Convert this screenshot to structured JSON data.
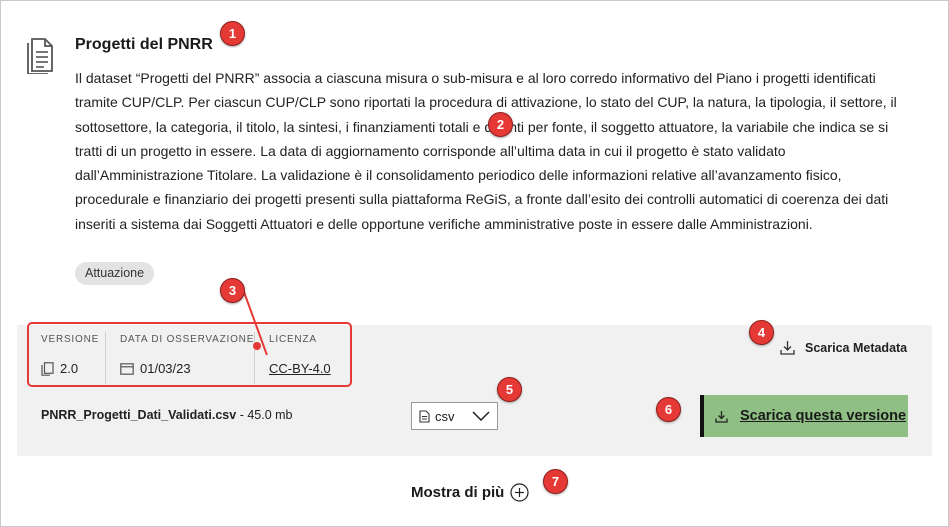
{
  "dataset": {
    "title": "Progetti del PNRR",
    "description": "Il dataset “Progetti del PNRR” associa a ciascuna misura o sub-misura e al loro corredo informativo del Piano i progetti identificati tramite CUP/CLP. Per ciascun CUP/CLP sono riportati la procedura di attivazione, lo stato del CUP, la natura, la tipologia, il settore, il sottosettore, la categoria, il titolo, la sintesi, i finanziamenti totali e distinti per fonte, il soggetto attuatore, la variabile che indica se si tratti di un progetto in essere. La data di aggiornamento corrisponde all’ultima data in cui il progetto è stato validato dall’Amministrazione Titolare. La validazione è il consolidamento periodico delle informazioni relative all’avanzamento fisico, procedurale e finanziario dei progetti presenti sulla piattaforma ReGiS, a fronte dall’esito dei controlli automatici di coerenza dei dati inseriti a sistema dai Soggetti Attuatori e delle opportune verifiche amministrative poste in essere dalle Amministrazioni.",
    "tag": "Attuazione"
  },
  "metadata": {
    "version_label": "VERSIONE",
    "version_value": "2.0",
    "date_label": "DATA DI OSSERVAZIONE",
    "date_value": "01/03/23",
    "license_label": "LICENZA",
    "license_value": "CC-BY-4.0"
  },
  "download_metadata_label": "Scarica Metadata",
  "file": {
    "name": "PNRR_Progetti_Dati_Validati.csv",
    "size": " - 45.0 mb"
  },
  "format_select": {
    "selected": "csv"
  },
  "download_button_label": "Scarica questa versione",
  "show_more_label": "Mostra di più",
  "markers": [
    "1",
    "2",
    "3",
    "4",
    "5",
    "6",
    "7"
  ],
  "icons": {
    "document": "document-icon",
    "version": "copy-icon",
    "date": "calendar-icon",
    "download": "download-icon",
    "file": "file-icon",
    "chevron": "chevron-down-icon",
    "plus": "plus-circle-icon"
  },
  "colors": {
    "accent_red": "#e53935",
    "button_green": "#8fbf84",
    "panel_gray": "#f1f1f1",
    "tag_gray": "#e3e3e3"
  }
}
